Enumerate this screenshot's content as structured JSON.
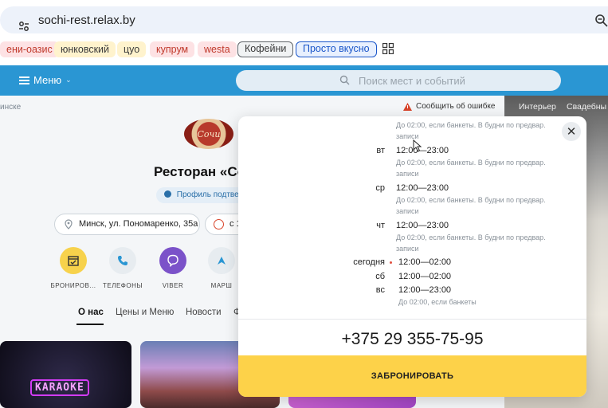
{
  "browser": {
    "url": "sochi-rest.relax.by",
    "bookmarks": [
      {
        "label": "ени-оазис",
        "bg": "#fde2e4",
        "color": "#c0392b"
      },
      {
        "label": "юнковский",
        "bg": "#fff3cd",
        "color": "#3a3a3a"
      },
      {
        "label": "цуо",
        "bg": "#fff3cd",
        "color": "#3a3a3a"
      },
      {
        "label": "купрум",
        "bg": "#fde2e4",
        "color": "#c0392b"
      },
      {
        "label": "westa",
        "bg": "#fde2e4",
        "color": "#c0392b"
      },
      {
        "label": "Кофейни",
        "bg": "#f1f3f4",
        "color": "#3a3a3a"
      },
      {
        "label": "Просто вкусно",
        "bg": "#e8f0fe",
        "color": "#1a56c9"
      }
    ]
  },
  "header": {
    "menu_label": "Меню",
    "search_placeholder": "Поиск мест и событий",
    "accent": "#2a96d3"
  },
  "page": {
    "breadcrumb": "инске",
    "report_label": "Сообщить об ошибке",
    "logo_text": "Сочи",
    "title": "Ресторан «Со",
    "verified_label": "Профиль подтвер",
    "address": "Минск, ул. Пономаренко, 35а",
    "hours_short": "с 1",
    "actions": [
      {
        "label": "БРОНИРОВ...",
        "icon": "calendar-icon",
        "bg": "#f7d24c"
      },
      {
        "label": "ТЕЛЕФОНЫ",
        "icon": "phone-icon",
        "bg": "#e7ecf0"
      },
      {
        "label": "VIBER",
        "icon": "viber-icon",
        "bg": "#7b52c9"
      },
      {
        "label": "МАРШ",
        "icon": "route-icon",
        "bg": "#e7ecf0"
      }
    ],
    "tabs": [
      "О нас",
      "Цены и Меню",
      "Новости",
      "Ф"
    ],
    "karaoke_sign": "KARAOKE"
  },
  "right_panel": {
    "tabs": [
      "Интерьер",
      "Свадебны"
    ]
  },
  "modal": {
    "top_note": "До 02:00, если банкеты. В будни по предвар. записи",
    "rows": [
      {
        "day": "вт",
        "hours": "12:00—23:00",
        "note": "До 02:00, если банкеты. В будни по предвар. записи"
      },
      {
        "day": "ср",
        "hours": "12:00—23:00",
        "note": "До 02:00, если банкеты. В будни по предвар. записи"
      },
      {
        "day": "чт",
        "hours": "12:00—23:00",
        "note": "До 02:00, если банкеты. В будни по предвар. записи"
      },
      {
        "day": "сегодня",
        "hours": "12:00—02:00",
        "note": ""
      },
      {
        "day": "сб",
        "hours": "12:00—02:00",
        "note": ""
      },
      {
        "day": "вс",
        "hours": "12:00—23:00",
        "note": "До 02:00, если банкеты"
      }
    ],
    "close_label": "✕",
    "phone": "+375 29 355-75-95",
    "book_label": "ЗАБРОНИРОВАТЬ",
    "book_color": "#fdd249"
  }
}
